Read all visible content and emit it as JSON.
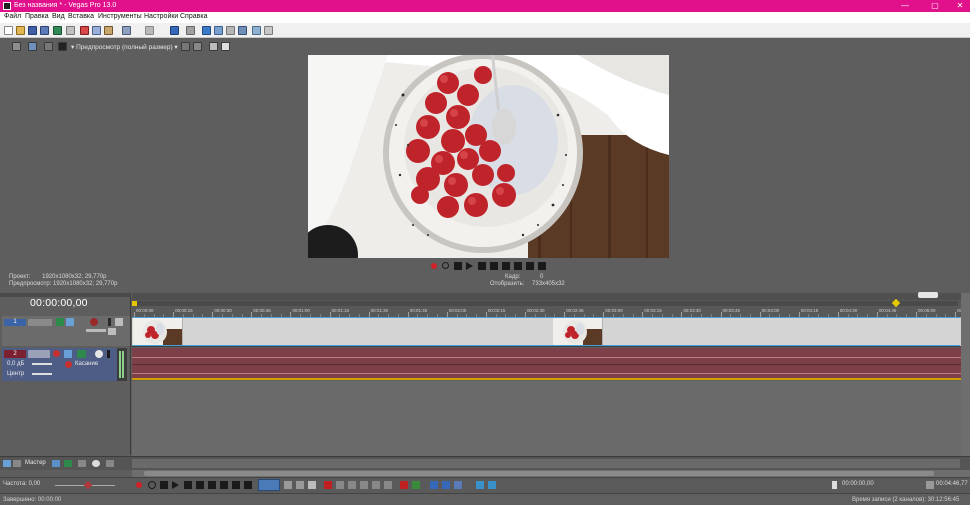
{
  "window": {
    "title": "Без названия * - Vegas Pro 13.0",
    "buttons": [
      "—",
      "▢",
      "✕"
    ]
  },
  "menu": [
    "Файл",
    "Правка",
    "Вид",
    "Вставка",
    "Инструменты",
    "Настройки",
    "Справка"
  ],
  "preview": {
    "mode_label": "Предпросмотр (полный размер)"
  },
  "project_info": {
    "project_label": "Проект:",
    "project_value": "1920x1080x32; 29,770р",
    "preview_label": "Предпросмотр:",
    "preview_value": "1920x1080x32; 29,770р",
    "frame_label": "Кадр:",
    "frame_value": "0",
    "display_label": "Отобразить:",
    "display_value": "733x405x32"
  },
  "timeline": {
    "timecode": "00:00:00,00",
    "ruler_labels": [
      "00:00:00",
      "00:00:15",
      "00:00:30",
      "00:00:45",
      "00:01:00",
      "00:01:15",
      "00:01:30",
      "00:01:45",
      "00:02:00",
      "00:02:15",
      "00:02:30",
      "00:02:45",
      "00:03:00",
      "00:03:15",
      "00:03:30",
      "00:03:45",
      "00:04:00",
      "00:04:15",
      "00:04:30",
      "00:04:45",
      "00:05:00",
      "00:05:15"
    ]
  },
  "video_track": {
    "number": "1"
  },
  "audio_track": {
    "number": "2",
    "volume": "0,0 дБ",
    "mode": "Касание",
    "pan": "Центр"
  },
  "master": {
    "label": "Мастер"
  },
  "bottom": {
    "rate_label": "Частота: 0,00",
    "timecode_right": "00:00:00,00",
    "timecode_end": "00:04:46,77"
  },
  "status": {
    "left": "Завершено: 00:00:00",
    "right": "Время записи (2 каналов): 30:12:56:45"
  },
  "colors": {
    "titlebar": "#e0118a",
    "audio_track": "#7d3f48",
    "audio_header": "#4d5d86",
    "record": "#d0202a"
  }
}
